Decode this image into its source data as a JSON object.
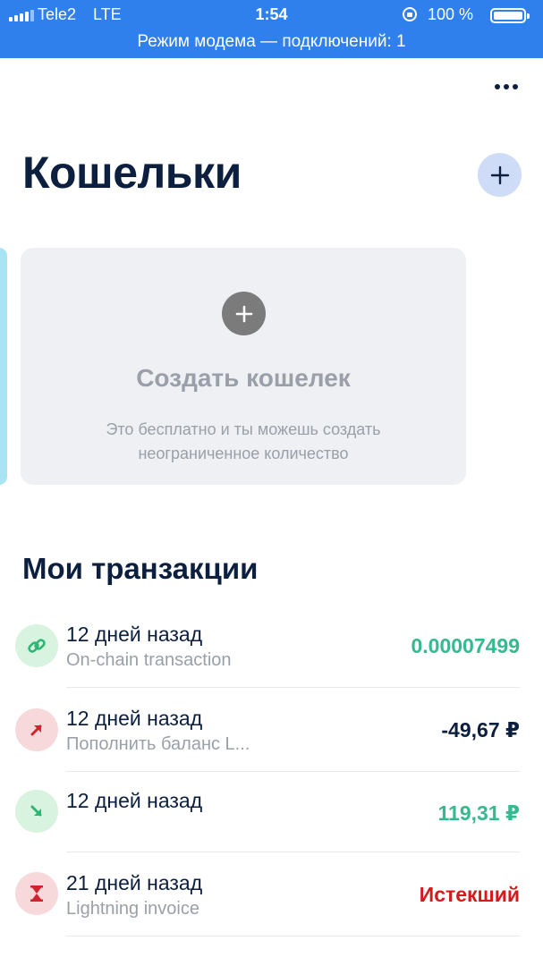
{
  "status_bar": {
    "carrier": "Tele2",
    "network": "LTE",
    "time": "1:54",
    "battery": "100 %",
    "hotspot": "Режим модема — подключений: 1"
  },
  "header": {
    "title": "Кошельки",
    "more_icon": "more-horizontal-icon",
    "add_icon": "plus-icon"
  },
  "create_wallet": {
    "title": "Создать кошелек",
    "description_line1": "Это бесплатно и ты можешь создать",
    "description_line2": "неограниченное количество",
    "icon": "plus-icon"
  },
  "transactions_section": {
    "title": "Мои транзакции"
  },
  "transactions": [
    {
      "date": "12 дней назад",
      "description": "On-chain transaction",
      "value": "0.00007499",
      "value_color": "#35b98f",
      "icon": "link-icon",
      "icon_bg": "#d8f3df",
      "icon_color": "#2fb574"
    },
    {
      "date": "12 дней назад",
      "description": "Пополнить баланс L...",
      "value": "-49,67 ₽",
      "value_color": "#0c1f3f",
      "icon": "arrow-up-right-icon",
      "icon_bg": "#f8d9db",
      "icon_color": "#d0222f"
    },
    {
      "date": "12 дней назад",
      "description": "",
      "value": "119,31 ₽",
      "value_color": "#35b98f",
      "icon": "arrow-down-right-icon",
      "icon_bg": "#d8f3df",
      "icon_color": "#2fb574"
    },
    {
      "date": "21 дней назад",
      "description": "Lightning invoice",
      "value": "Истекший",
      "value_color": "#d41b1b",
      "icon": "hourglass-icon",
      "icon_bg": "#f8d9db",
      "icon_color": "#d0222f"
    }
  ],
  "colors": {
    "status_bar_bg": "#2f80ed",
    "title": "#0c1f3f",
    "muted": "#9aa0a9",
    "positive": "#35b98f",
    "negative_status": "#d41b1b"
  }
}
